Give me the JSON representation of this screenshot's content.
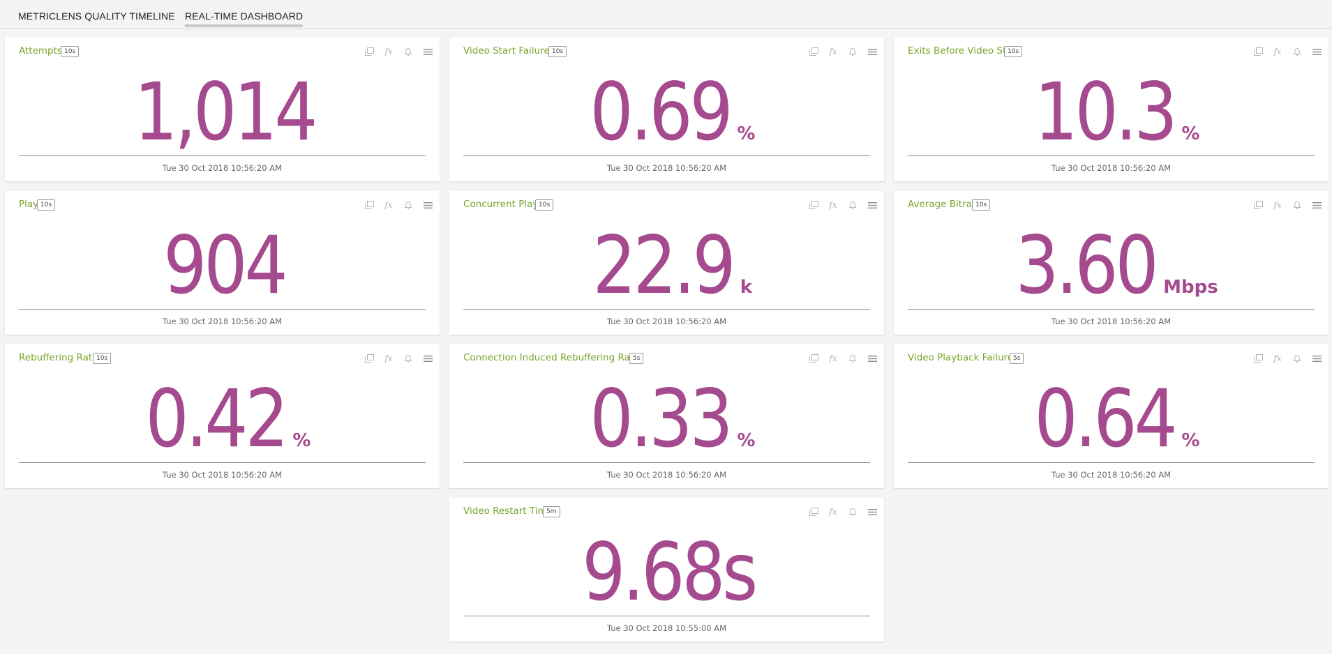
{
  "tabs": [
    {
      "label": "METRICLENS QUALITY TIMELINE",
      "active": false
    },
    {
      "label": "REAL-TIME DASHBOARD",
      "active": true
    }
  ],
  "colors": {
    "title": "#77a52b",
    "value": "#a54a8e",
    "background": "#f4f4f4"
  },
  "card_icons": [
    "copy-icon",
    "fx-icon",
    "bell-icon",
    "menu-icon"
  ],
  "fx_label": "fx",
  "cards": [
    {
      "title": "Attempts",
      "interval": "10s",
      "value": "1,014",
      "unit": "",
      "timestamp": "Tue 30 Oct 2018 10:56:20 AM"
    },
    {
      "title": "Video Start Failures",
      "interval": "10s",
      "value": "0.69",
      "unit": "%",
      "timestamp": "Tue 30 Oct 2018 10:56:20 AM"
    },
    {
      "title": "Exits Before Video Start",
      "interval": "10s",
      "value": "10.3",
      "unit": "%",
      "timestamp": "Tue 30 Oct 2018 10:56:20 AM"
    },
    {
      "title": "Plays",
      "interval": "10s",
      "value": "904",
      "unit": "",
      "timestamp": "Tue 30 Oct 2018 10:56:20 AM"
    },
    {
      "title": "Concurrent Plays",
      "interval": "10s",
      "value": "22.9",
      "unit": "k",
      "timestamp": "Tue 30 Oct 2018 10:56:20 AM"
    },
    {
      "title": "Average Bitrate",
      "interval": "10s",
      "value": "3.60",
      "unit": "Mbps",
      "timestamp": "Tue 30 Oct 2018 10:56:20 AM"
    },
    {
      "title": "Rebuffering Ratio",
      "interval": "10s",
      "value": "0.42",
      "unit": "%",
      "timestamp": "Tue 30 Oct 2018 10:56:20 AM"
    },
    {
      "title": "Connection Induced Rebuffering Ratio",
      "interval": "5s",
      "value": "0.33",
      "unit": "%",
      "timestamp": "Tue 30 Oct 2018 10:56:20 AM"
    },
    {
      "title": "Video Playback Failures",
      "interval": "5s",
      "value": "0.64",
      "unit": "%",
      "timestamp": "Tue 30 Oct 2018 10:56:20 AM"
    },
    {
      "title": "Video Restart Time",
      "interval": "5m",
      "value": "9.68s",
      "unit": "",
      "timestamp": "Tue 30 Oct 2018 10:55:00 AM"
    }
  ]
}
